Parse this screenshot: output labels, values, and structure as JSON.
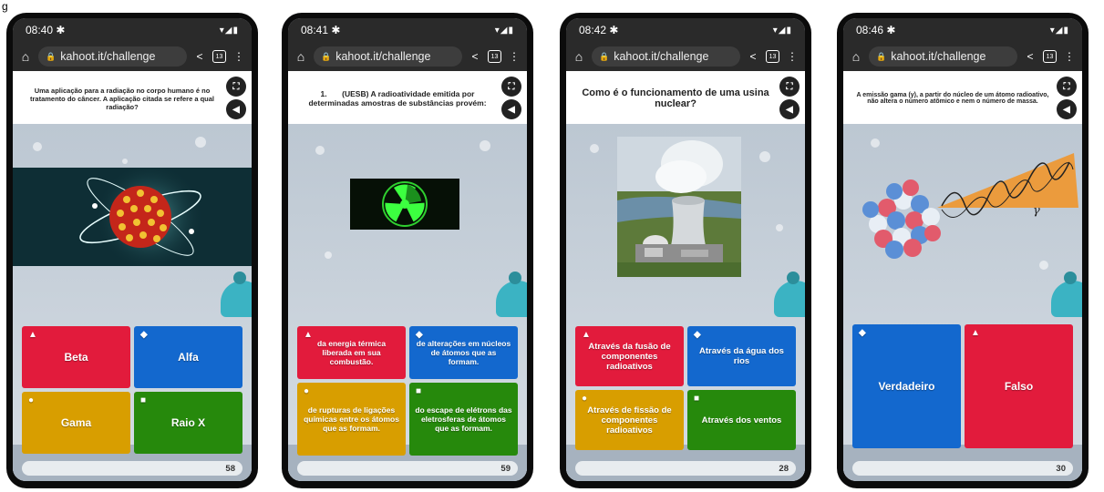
{
  "figure_label": "g",
  "phones": [
    {
      "time": "08:40",
      "url": "kahoot.it/challenge",
      "tab_count": "13",
      "question": "Uma aplicação para a radiação no corpo humano é no tratamento do câncer. A aplicação citada se refere a qual radiação?",
      "image": "virus-cell-with-orbits",
      "answers": [
        {
          "symbol": "▲",
          "label": "Beta",
          "color": "#e21b3c"
        },
        {
          "symbol": "◆",
          "label": "Alfa",
          "color": "#1368ce"
        },
        {
          "symbol": "●",
          "label": "Gama",
          "color": "#d89e00"
        },
        {
          "symbol": "■",
          "label": "Raio X",
          "color": "#26890c"
        }
      ],
      "counter": "58"
    },
    {
      "time": "08:41",
      "url": "kahoot.it/challenge",
      "tab_count": "13",
      "question": "1.       (UESB) A radioatividade emitida por determinadas amostras de substâncias provém:",
      "image": "radiation-symbol",
      "answers": [
        {
          "symbol": "▲",
          "label": "da energia térmica liberada em sua combustão.",
          "color": "#e21b3c"
        },
        {
          "symbol": "◆",
          "label": "de alterações em núcleos de átomos que as formam.",
          "color": "#1368ce"
        },
        {
          "symbol": "●",
          "label": "de rupturas de ligações químicas entre os átomos que as formam.",
          "color": "#d89e00"
        },
        {
          "symbol": "■",
          "label": "do escape de elétrons das eletrosferas de átomos que as formam.",
          "color": "#26890c"
        }
      ],
      "counter": "59"
    },
    {
      "time": "08:42",
      "url": "kahoot.it/challenge",
      "tab_count": "13",
      "question": "Como é o funcionamento de uma usina nuclear?",
      "image": "nuclear-plant-photo",
      "answers": [
        {
          "symbol": "▲",
          "label": "Através da fusão de componentes radioativos",
          "color": "#e21b3c"
        },
        {
          "symbol": "◆",
          "label": "Através da água dos rios",
          "color": "#1368ce"
        },
        {
          "symbol": "●",
          "label": "Através de fissão de componentes radioativos",
          "color": "#d89e00"
        },
        {
          "symbol": "■",
          "label": "Através dos ventos",
          "color": "#26890c"
        }
      ],
      "counter": "28"
    },
    {
      "time": "08:46",
      "url": "kahoot.it/challenge",
      "tab_count": "13",
      "question": "A emissão gama (γ), a partir do núcleo de um átomo radioativo, não altera o número atômico e nem o número de massa.",
      "image": "nucleus-gamma-emission",
      "gamma_label": "γ",
      "answers": [
        {
          "symbol": "◆",
          "label": "Verdadeiro",
          "color": "#1368ce"
        },
        {
          "symbol": "▲",
          "label": "Falso",
          "color": "#e21b3c"
        }
      ],
      "counter": "30"
    }
  ]
}
